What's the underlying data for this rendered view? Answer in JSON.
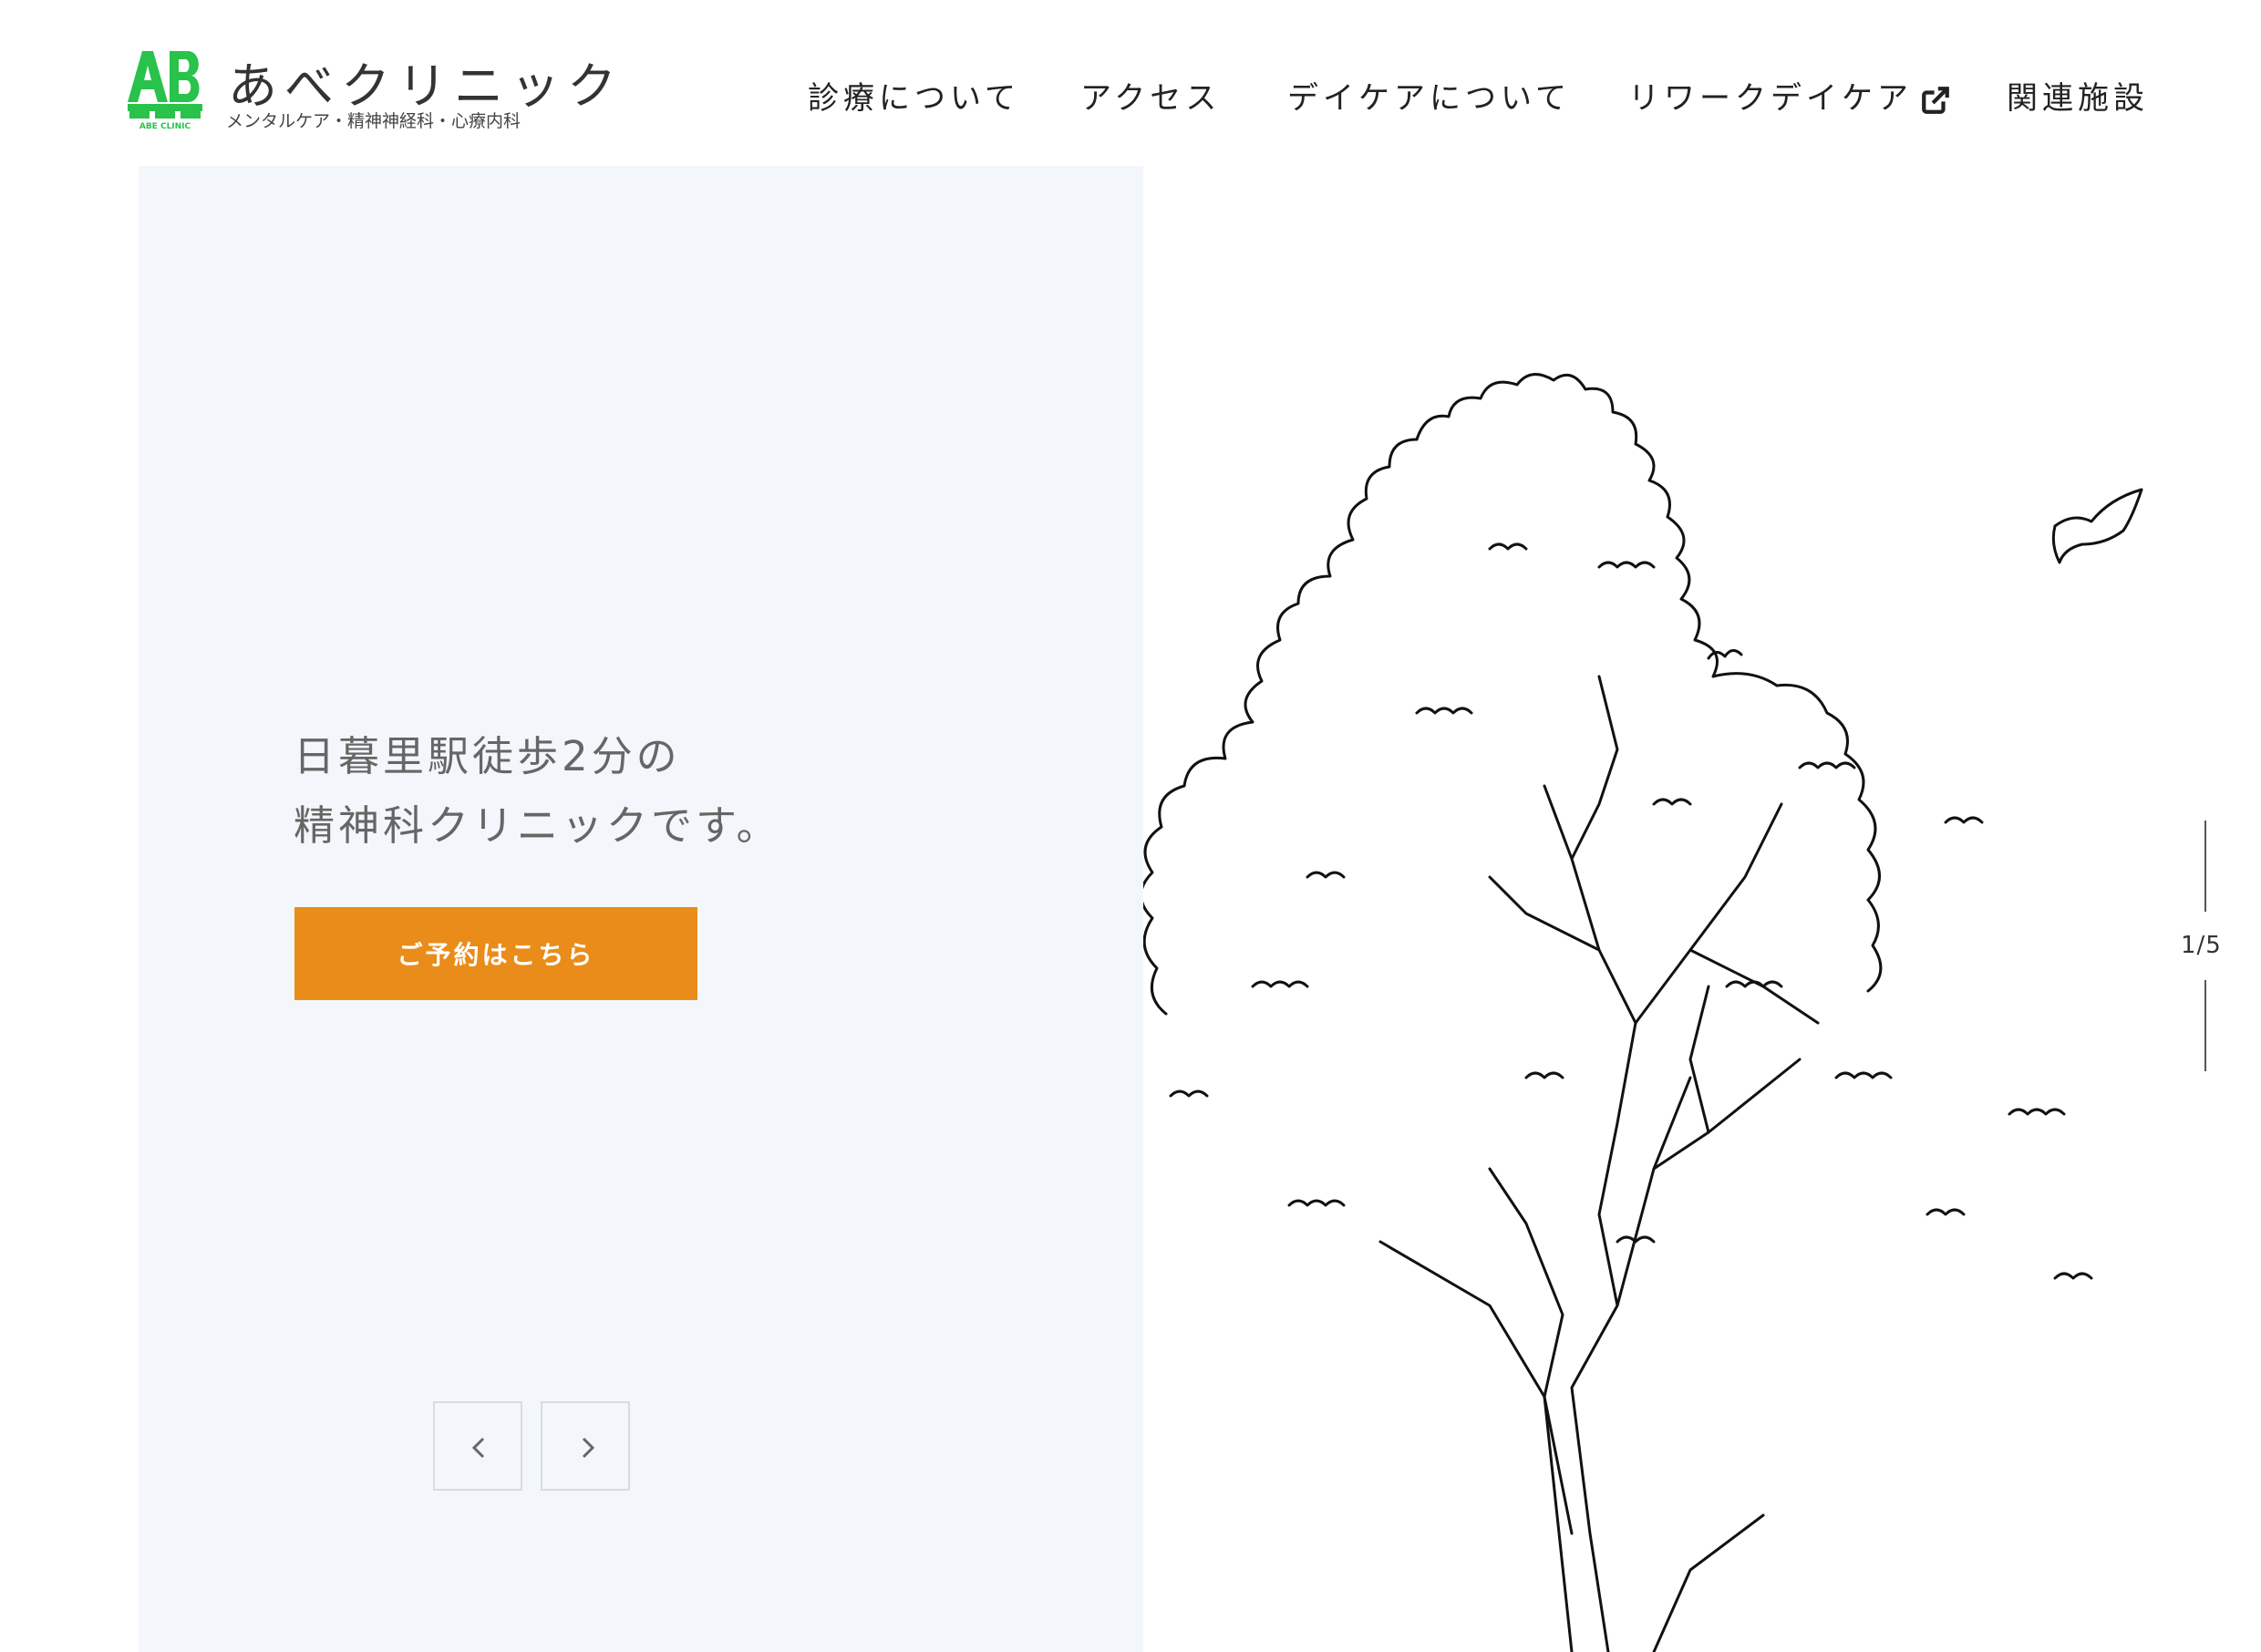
{
  "brand": {
    "name": "あべクリニック",
    "subtitle": "メンタルケア・精神神経科・心療内科",
    "mark_letters": "AB",
    "mark_caption": "ABE CLINIC",
    "color": "#29c24a"
  },
  "nav": {
    "items": [
      {
        "label": "診療について"
      },
      {
        "label": "アクセス"
      },
      {
        "label": "デイケアについて"
      },
      {
        "label": "リワークデイケア",
        "external": true
      },
      {
        "label": "関連施設"
      }
    ]
  },
  "hero": {
    "line1": "日暮里駅徒歩2分の",
    "line2": "精神科クリニックです。",
    "cta_label": "ご予約はこちら",
    "cta_color": "#ea8c19",
    "background": "#f3f7fb"
  },
  "slider": {
    "current": 1,
    "total": 5,
    "counter_text": "1/5",
    "prev_icon": "chevron-left-icon",
    "next_icon": "chevron-right-icon"
  }
}
